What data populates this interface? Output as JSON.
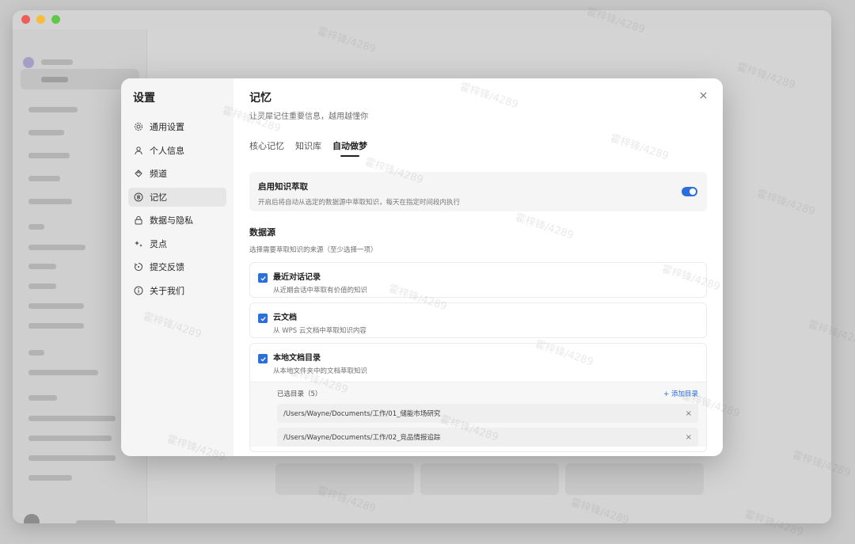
{
  "settings": {
    "title": "设置",
    "nav": [
      {
        "label": "通用设置",
        "icon": "gear-icon"
      },
      {
        "label": "个人信息",
        "icon": "user-icon"
      },
      {
        "label": "频道",
        "icon": "channel-icon"
      },
      {
        "label": "记忆",
        "icon": "memory-icon",
        "active": true
      },
      {
        "label": "数据与隐私",
        "icon": "lock-icon"
      },
      {
        "label": "灵点",
        "icon": "sparkle-icon"
      },
      {
        "label": "提交反馈",
        "icon": "feedback-icon"
      },
      {
        "label": "关于我们",
        "icon": "info-icon"
      }
    ]
  },
  "memory": {
    "title": "记忆",
    "subtitle": "让灵犀记住重要信息，越用越懂你",
    "tabs": [
      {
        "label": "核心记忆",
        "active": false
      },
      {
        "label": "知识库",
        "active": false
      },
      {
        "label": "自动做梦",
        "active": true
      }
    ],
    "toggle_card": {
      "title": "启用知识萃取",
      "desc": "开启后将自动从选定的数据源中萃取知识，每天在指定时间段内执行",
      "enabled": true
    },
    "data_source": {
      "title": "数据源",
      "desc": "选择需要萃取知识的来源（至少选择一项）",
      "sources": [
        {
          "title": "最近对话记录",
          "desc": "从近期会话中萃取有价值的知识",
          "checked": true
        },
        {
          "title": "云文档",
          "desc": "从 WPS 云文档中萃取知识内容",
          "checked": true
        },
        {
          "title": "本地文档目录",
          "desc": "从本地文件夹中的文档萃取知识",
          "checked": true
        }
      ],
      "dirs_label": "已选目录（5）",
      "add_dir": "+ 添加目录",
      "dirs": [
        "/Users/Wayne/Documents/工作/01_储能市场研究",
        "/Users/Wayne/Documents/工作/02_竞品情报追踪"
      ],
      "remove_glyph": "×"
    }
  },
  "close_glyph": "×",
  "watermark": "霍梓锋/4289",
  "colors": {
    "accent": "#2a6fdb"
  }
}
